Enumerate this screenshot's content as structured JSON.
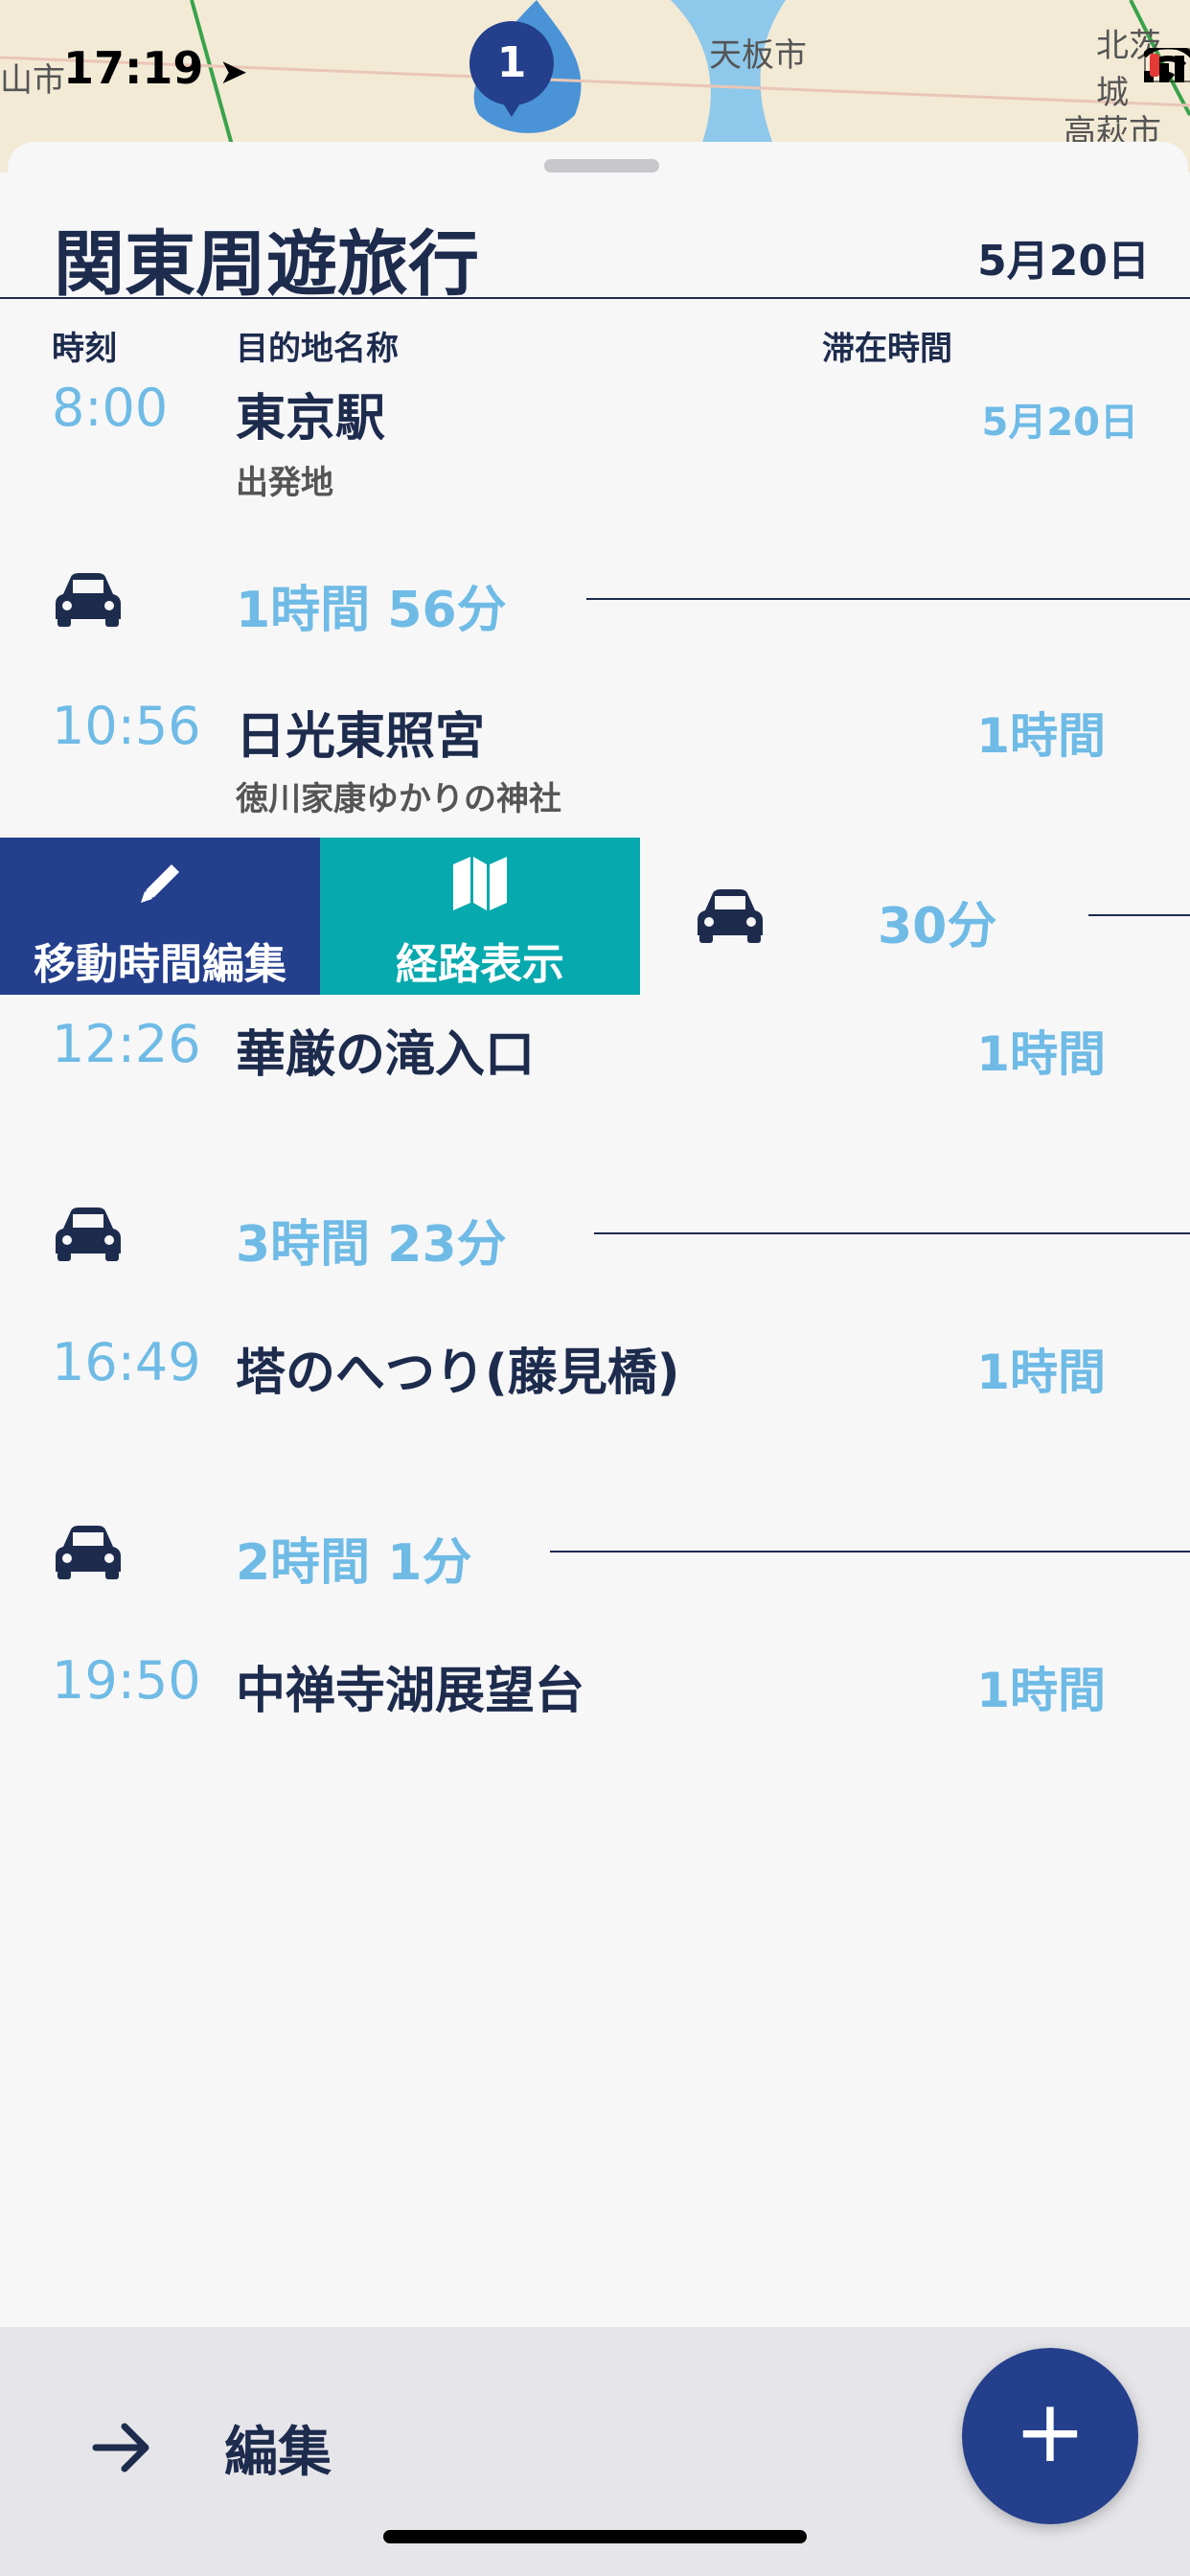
{
  "status": {
    "time": "17:19",
    "map_labels": [
      "山市",
      "天板市",
      "北茨城",
      "高萩市"
    ],
    "pin_number": "1"
  },
  "header": {
    "title": "関東周遊旅行",
    "date": "5月20日"
  },
  "columns": {
    "time": "時刻",
    "destination": "目的地名称",
    "stay": "滞在時間"
  },
  "stops": [
    {
      "time": "8:00",
      "name": "東京駅",
      "subtitle": "出発地",
      "stay": "5月20日"
    },
    {
      "time": "10:56",
      "name": "日光東照宮",
      "subtitle": "徳川家康ゆかりの神社",
      "stay": "1時間"
    },
    {
      "time": "12:26",
      "name": "華厳の滝入口",
      "subtitle": "",
      "stay": "1時間"
    },
    {
      "time": "16:49",
      "name": "塔のへつり(藤見橋)",
      "subtitle": "",
      "stay": "1時間"
    },
    {
      "time": "19:50",
      "name": "中禅寺湖展望台",
      "subtitle": "",
      "stay": "1時間"
    }
  ],
  "travels": [
    {
      "icon": "car-icon",
      "duration": "1時間 56分"
    },
    {
      "icon": "car-icon",
      "duration": "30分"
    },
    {
      "icon": "car-icon",
      "duration": "3時間 23分"
    },
    {
      "icon": "car-icon",
      "duration": "2時間 1分"
    }
  ],
  "swipe_actions": {
    "edit_label": "移動時間編集",
    "route_label": "経路表示",
    "edit_icon": "pencil-icon",
    "route_icon": "map-icon"
  },
  "bottom": {
    "edit_label": "編集",
    "fab_label": "+"
  },
  "colors": {
    "navy": "#1d2b4d",
    "accent_blue": "#243f8c",
    "light_blue": "#6fbbe6",
    "teal": "#06a9ad"
  }
}
